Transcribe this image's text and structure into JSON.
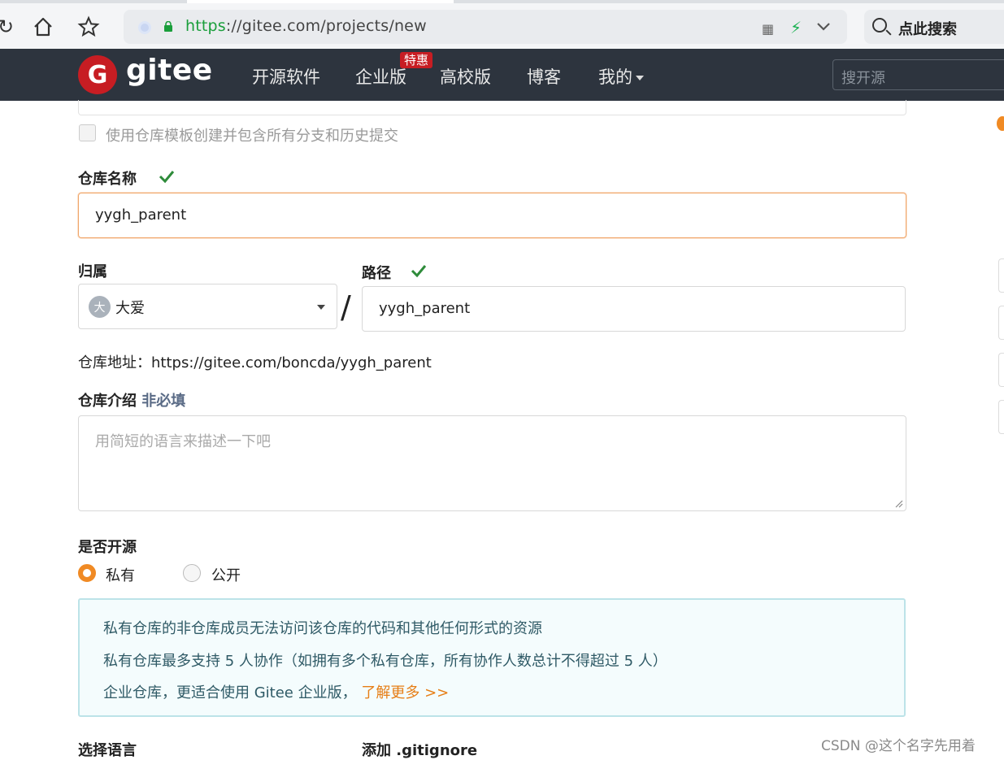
{
  "browser": {
    "url_scheme": "https",
    "url_rest": "://gitee.com/projects/new",
    "search_label": "点此搜索"
  },
  "header": {
    "logo_letter": "G",
    "logo_text": "gitee",
    "menu": [
      "开源软件",
      "企业版",
      "高校版",
      "博客",
      "我的"
    ],
    "badge": "特惠",
    "search_placeholder": "搜开源"
  },
  "form": {
    "template_checkbox_label": "使用仓库模板创建并包含所有分支和历史提交",
    "repo_name_label": "仓库名称",
    "repo_name_value": "yygh_parent",
    "owner_label": "归属",
    "owner_avatar": "大",
    "owner_value": "大爱",
    "path_label": "路径",
    "path_value": "yygh_parent",
    "address_text": "仓库地址：https://gitee.com/boncda/yygh_parent",
    "intro_label": "仓库介绍",
    "intro_optional": "非必填",
    "intro_placeholder": "用简短的语言来描述一下吧",
    "opensource_label": "是否开源",
    "private_label": "私有",
    "public_label": "公开",
    "notice_lines": [
      "私有仓库的非仓库成员无法访问该仓库的代码和其他任何形式的资源",
      "私有仓库最多支持 5 人协作（如拥有多个私有仓库，所有协作人数总计不得超过 5 人）",
      "企业仓库，更适合使用 Gitee 企业版，"
    ],
    "learn_more": "了解更多 >>",
    "language_label": "选择语言",
    "gitignore_label": "添加 .gitignore"
  },
  "watermark": "CSDN @这个名字先用着",
  "colors": {
    "header_bg": "#2d343e",
    "brand_red": "#c71d23",
    "accent_orange": "#f08a24",
    "check_green": "#2e8b3a"
  }
}
